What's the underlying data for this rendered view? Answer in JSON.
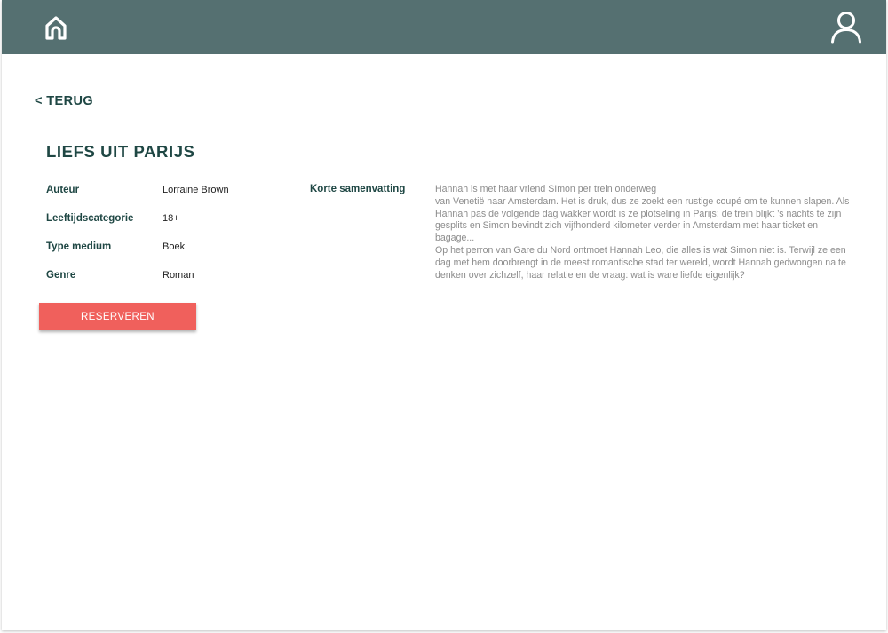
{
  "header": {
    "home_icon": "home-icon",
    "user_icon": "user-icon",
    "background_color": "#557071"
  },
  "back_link": "< TERUG",
  "book": {
    "title": "LIEFS UIT PARIJS",
    "details": [
      {
        "label": "Auteur",
        "value": "Lorraine Brown"
      },
      {
        "label": "Leeftijdscategorie",
        "value": "18+"
      },
      {
        "label": "Type medium",
        "value": "Boek"
      },
      {
        "label": "Genre",
        "value": "Roman"
      }
    ],
    "summary_label": "Korte samenvatting",
    "summary_paragraphs": [
      "Hannah is met haar vriend SImon per trein onderweg",
      "van Venetië naar Amsterdam. Het is druk, dus ze zoekt een rustige coupé om te kunnen slapen. Als Hannah pas de volgende dag wakker wordt is ze plotseling in Parijs: de trein blijkt ’s nachts te zijn gesplits en Simon bevindt zich vijfhonderd kilometer verder in Amsterdam met haar ticket en bagage...",
      "Op het perron van Gare du Nord ontmoet Hannah Leo, die alles is wat Simon niet is. Terwijl ze een dag met hem doorbrengt in de meest romantische stad ter wereld, wordt Hannah gedwongen na te denken over zichzelf, haar relatie en de vraag: wat is ware liefde eigenlijk?"
    ]
  },
  "actions": {
    "reserve_label": "RESERVEREN",
    "reserve_color": "#f0605c"
  }
}
